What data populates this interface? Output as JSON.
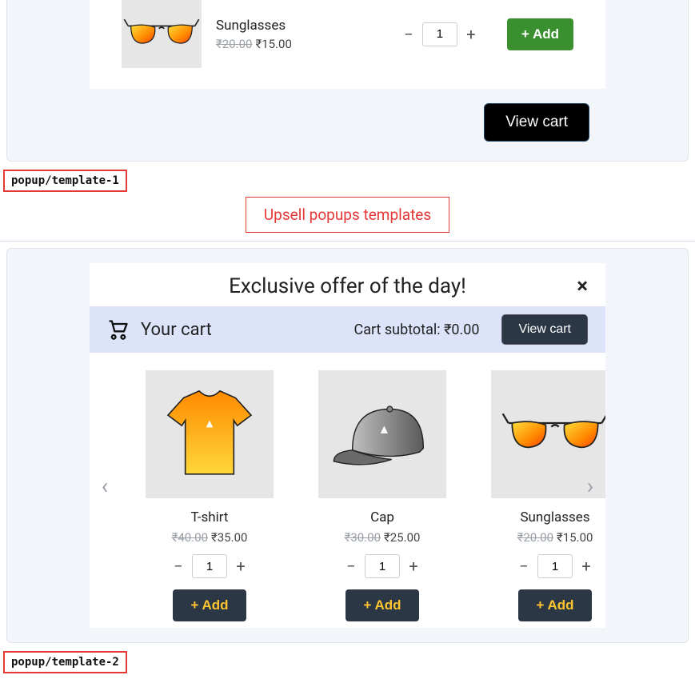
{
  "labels": {
    "t1": "popup/template-1",
    "t2": "popup/template-2",
    "section": "Upsell popups templates"
  },
  "common": {
    "plus": "+",
    "minus": "−",
    "add_label": "+ Add",
    "view_cart": "View cart"
  },
  "t1": {
    "product": {
      "name": "Sunglasses",
      "old": "₹20.00",
      "new": "₹15.00",
      "qty": "1"
    }
  },
  "t2": {
    "title": "Exclusive offer of the day!",
    "close": "×",
    "your_cart": "Your cart",
    "subtotal_label": "Cart subtotal: ",
    "subtotal_value": "₹0.00",
    "products": [
      {
        "name": "T-shirt",
        "old": "₹40.00",
        "new": "₹35.00",
        "qty": "1",
        "icon": "tshirt"
      },
      {
        "name": "Cap",
        "old": "₹30.00",
        "new": "₹25.00",
        "qty": "1",
        "icon": "cap"
      },
      {
        "name": "Sunglasses",
        "old": "₹20.00",
        "new": "₹15.00",
        "qty": "1",
        "icon": "sunglasses"
      }
    ]
  }
}
